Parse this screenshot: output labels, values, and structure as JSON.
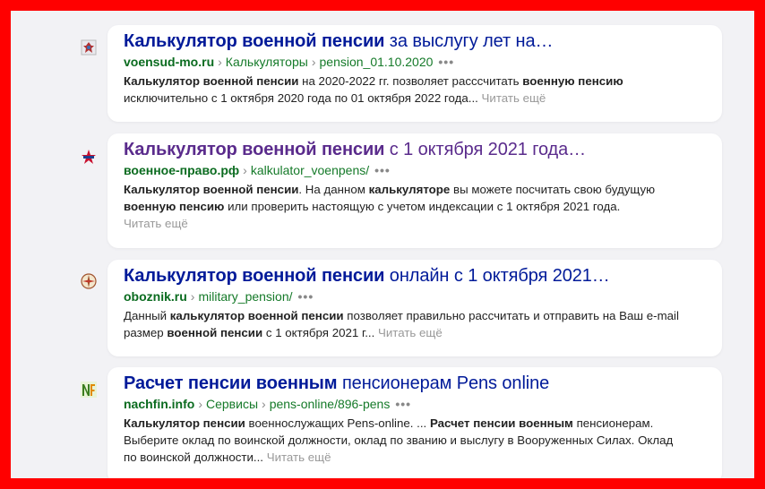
{
  "results": [
    {
      "title_bold": "Калькулятор военной пенсии",
      "title_rest": " за выслугу лет на…",
      "visited": false,
      "host": "voensud-mo.ru",
      "path": [
        "Калькуляторы",
        "pension_01.10.2020"
      ],
      "more_dots": "•••",
      "favicon": "voensud-emblem-icon",
      "snippet": [
        {
          "b": "Калькулятор военной пенсии"
        },
        {
          "t": " на 2020-2022 гг. позволяет расссчитать "
        },
        {
          "b": "военную пенсию"
        },
        {
          "br": true
        },
        {
          "t": "исключительно с 1 октября 2020 года по 01 октября 2022 года... "
        }
      ],
      "read_more": "Читать ещё"
    },
    {
      "title_bold": "Калькулятор военной пенсии",
      "title_rest": " с 1 октября 2021 года…",
      "visited": true,
      "host": "военное-право.рф",
      "path": [
        "kalkulator_voenpens/"
      ],
      "more_dots": "•••",
      "favicon": "star-emblem-icon",
      "snippet": [
        {
          "b": "Калькулятор военной пенсии"
        },
        {
          "t": ". На данном "
        },
        {
          "b": "калькуляторе"
        },
        {
          "t": " вы можете посчитать свою будущую"
        },
        {
          "br": true
        },
        {
          "b": "военную пенсию"
        },
        {
          "t": " или проверить настоящую с учетом индексации с 1 октября 2021 года."
        },
        {
          "br": true
        }
      ],
      "read_more": "Читать ещё"
    },
    {
      "title_bold": "Калькулятор военной пенсии",
      "title_rest": " онлайн с 1 октября 2021…",
      "visited": false,
      "host": "oboznik.ru",
      "path": [
        "military_pension/"
      ],
      "more_dots": "•••",
      "favicon": "compass-emblem-icon",
      "snippet": [
        {
          "t": "Данный "
        },
        {
          "b": "калькулятор военной пенсии"
        },
        {
          "t": " позволяет правильно рассчитать и отправить на Ваш e-mail"
        },
        {
          "br": true
        },
        {
          "t": "размер "
        },
        {
          "b": "военной пенсии"
        },
        {
          "t": " с 1 октября 2021 г... "
        }
      ],
      "read_more": "Читать ещё"
    },
    {
      "title_bold": "Расчет пенсии военным",
      "title_rest": " пенсионерам Pens online",
      "visited": false,
      "host": "nachfin.info",
      "path": [
        "Сервисы",
        "pens-online/896-pens"
      ],
      "more_dots": "•••",
      "favicon": "nf-logo-icon",
      "snippet": [
        {
          "b": "Калькулятор пенсии"
        },
        {
          "t": " военнослужащих Pens-online. ... "
        },
        {
          "b": "Расчет пенсии военным"
        },
        {
          "t": " пенсионерам."
        },
        {
          "br": true
        },
        {
          "t": "Выберите оклад по воинской должности, оклад по званию и выслугу в Вооруженных Силах. Оклад"
        },
        {
          "br": true
        },
        {
          "t": "по воинской должности... "
        }
      ],
      "read_more": "Читать ещё"
    }
  ]
}
